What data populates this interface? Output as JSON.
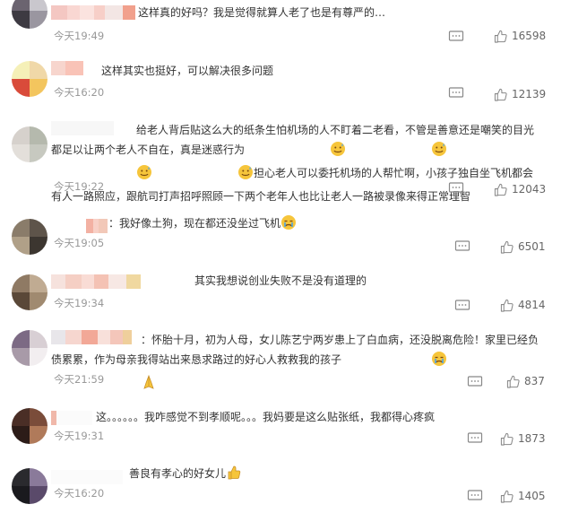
{
  "comments": [
    {
      "text": "这样真的好吗？我是觉得就算人老了也是有尊严的…",
      "time": "今天19:49",
      "likes": "16598"
    },
    {
      "text": "这样其实也挺好，可以解决很多问题",
      "time": "今天16:20",
      "likes": "12139"
    },
    {
      "text": "给老人背后贴这么大的纸条生怕机场的人不盯着二老看，不管是善意还是嘲笑的目光都足以让两个老人不自在，真是迷惑行为",
      "text2": "担心老人可以委托机场的人帮忙啊，小孩子独自坐飞机都会有人一路照应，跟航司打声招呼照顾一下两个老年人也比让老人一路被录像来得正常理智",
      "time": "今天19:22",
      "likes": "12043"
    },
    {
      "prefix": "：",
      "text": "我好像土狗，现在都还没坐过飞机",
      "time": "今天19:05",
      "likes": "6501"
    },
    {
      "text": "其实我想说创业失败不是没有道理的",
      "time": "今天19:34",
      "likes": "4814"
    },
    {
      "prefix": "：",
      "text": "怀胎十月，初为人母，女儿陈艺宁两岁患上了白血病，还没脱离危险！家里已经负债累累，作为母亲我得站出来恳求路过的好心人救救我的孩子",
      "time": "今天21:59",
      "likes": "837"
    },
    {
      "text": "这。。。。。。我咋感觉不到孝顺呢。。。我妈要是这么贴张纸，我都得心疼疯",
      "time": "今天19:31",
      "likes": "1873"
    },
    {
      "text": "善良有孝心的好女儿",
      "time": "今天16:20",
      "likes": "1405"
    }
  ],
  "icons": {
    "reply": "comment-icon",
    "like": "thumbs-up-icon"
  },
  "colors": {
    "time": "#999999",
    "text": "#333333",
    "icon": "#888888"
  }
}
